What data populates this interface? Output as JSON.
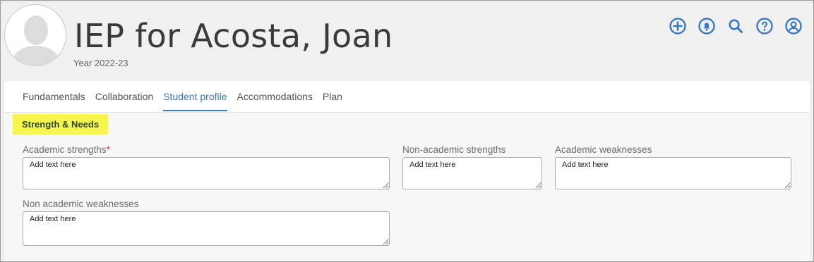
{
  "header": {
    "title": "IEP for Acosta, Joan",
    "year": "Year 2022-23",
    "icons": [
      "add-icon",
      "bell-icon",
      "search-icon",
      "help-icon",
      "account-icon"
    ]
  },
  "tabs": [
    {
      "label": "Fundamentals",
      "active": false
    },
    {
      "label": "Collaboration",
      "active": false
    },
    {
      "label": "Student profile",
      "active": true
    },
    {
      "label": "Accommodations",
      "active": false
    },
    {
      "label": "Plan",
      "active": false
    }
  ],
  "section": {
    "title": "Strength & Needs"
  },
  "fields": {
    "academic_strengths": {
      "label": "Academic strengths",
      "required_mark": "*",
      "placeholder": "Add text here"
    },
    "non_academic_strengths": {
      "label": "Non-academic strengths",
      "placeholder": "Add text here"
    },
    "academic_weaknesses": {
      "label": "Academic weaknesses",
      "placeholder": "Add text here"
    },
    "non_academic_weaknesses": {
      "label": "Non academic weaknesses",
      "placeholder": "Add text here"
    }
  },
  "colors": {
    "accent": "#3b78c4",
    "highlight": "#f6f54e",
    "required": "#d93025"
  }
}
